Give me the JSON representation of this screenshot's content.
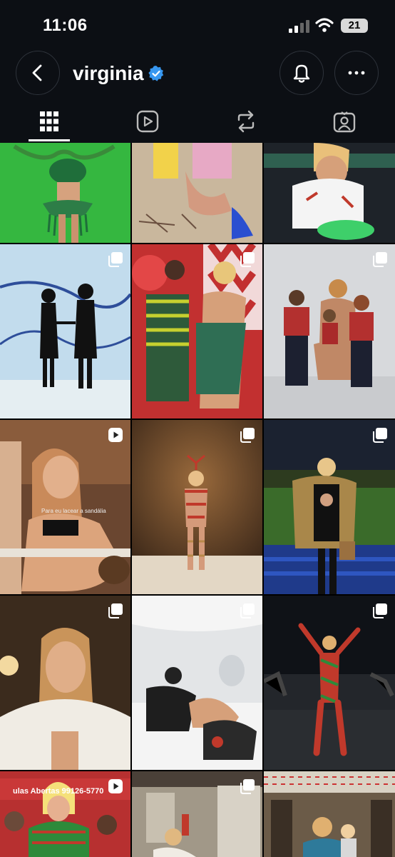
{
  "status_bar": {
    "time": "11:06",
    "battery": "21",
    "icons": [
      "cellular-signal-icon",
      "wifi-icon",
      "battery-icon"
    ]
  },
  "header": {
    "username": "virginia",
    "icons": [
      "back-arrow-icon",
      "verified-badge-icon",
      "notification-bell-icon",
      "more-options-icon"
    ],
    "accent_color": "#3797f0"
  },
  "tabs": {
    "items": [
      {
        "name": "posts",
        "icon": "grid-icon",
        "active": true
      },
      {
        "name": "reels",
        "icon": "reels-icon",
        "active": false
      },
      {
        "name": "reposts",
        "icon": "repost-icon",
        "active": false
      },
      {
        "name": "tagged",
        "icon": "tagged-icon",
        "active": false
      }
    ]
  },
  "grid": {
    "posts": [
      {
        "type": "photo",
        "badge": "none"
      },
      {
        "type": "photo",
        "badge": "none"
      },
      {
        "type": "photo",
        "badge": "none"
      },
      {
        "type": "carousel",
        "badge": "carousel-icon"
      },
      {
        "type": "carousel",
        "badge": "carousel-icon"
      },
      {
        "type": "carousel",
        "badge": "carousel-icon"
      },
      {
        "type": "reel",
        "badge": "reel-icon",
        "caption": "Para eu lacear a sandália"
      },
      {
        "type": "carousel",
        "badge": "carousel-icon"
      },
      {
        "type": "carousel",
        "badge": "carousel-icon"
      },
      {
        "type": "carousel",
        "badge": "carousel-icon"
      },
      {
        "type": "carousel",
        "badge": "carousel-icon"
      },
      {
        "type": "carousel",
        "badge": "carousel-icon"
      },
      {
        "type": "reel",
        "badge": "reel-icon",
        "sign": "ulas Abertas  99126-5770"
      },
      {
        "type": "carousel",
        "badge": "carousel-icon"
      },
      {
        "type": "photo",
        "badge": "none"
      }
    ]
  }
}
